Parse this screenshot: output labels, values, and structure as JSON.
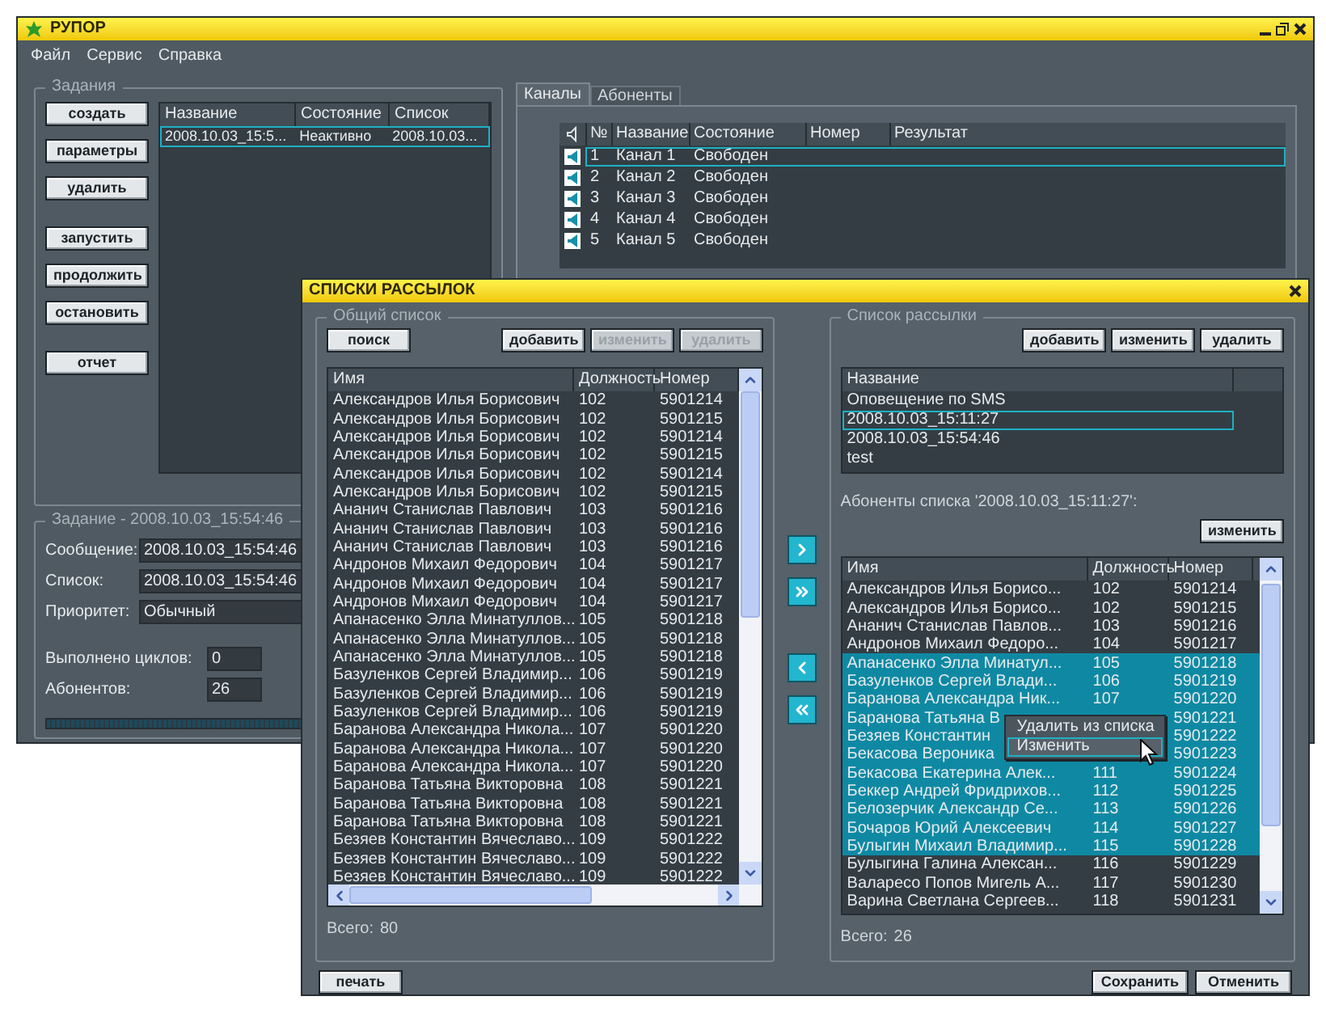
{
  "main_window": {
    "title": "РУПОР",
    "menu": [
      "Файл",
      "Сервис",
      "Справка"
    ],
    "tasks": {
      "title": "Задания",
      "button_groups": [
        [
          "создать",
          "параметры",
          "удалить"
        ],
        [
          "запустить",
          "продолжить",
          "остановить"
        ],
        [
          "отчет"
        ]
      ],
      "columns": [
        "Название",
        "Состояние",
        "Список"
      ],
      "rows": [
        {
          "cells": [
            "2008.10.03_15:5...",
            "Неактивно",
            "2008.10.03..."
          ],
          "selected": true
        }
      ]
    },
    "task": {
      "title": "Задание - 2008.10.03_15:54:46",
      "fields": [
        {
          "label": "Сообщение:",
          "value": "2008.10.03_15:54:46"
        },
        {
          "label": "Список:",
          "value": "2008.10.03_15:54:46"
        },
        {
          "label": "Приоритет:",
          "value": "Обычный"
        }
      ],
      "counters": [
        {
          "label": "Выполнено циклов:",
          "value": "0"
        },
        {
          "label": "Абонентов:",
          "value": "26"
        }
      ],
      "progress": {
        "level": 0
      }
    },
    "tabs": [
      {
        "label": "Каналы",
        "selected": true
      },
      {
        "label": "Абоненты",
        "selected": false
      }
    ],
    "channels": {
      "columns": [
        "№",
        "Название",
        "Состояние",
        "Номер",
        "Результат"
      ],
      "rows": [
        {
          "number": "1",
          "name": "Канал 1",
          "status": "Свободен",
          "selected": true
        },
        {
          "number": "2",
          "name": "Канал 2",
          "status": "Свободен",
          "selected": false
        },
        {
          "number": "3",
          "name": "Канал 3",
          "status": "Свободен",
          "selected": false
        },
        {
          "number": "4",
          "name": "Канал 4",
          "status": "Свободен",
          "selected": false
        },
        {
          "number": "5",
          "name": "Канал 5",
          "status": "Свободен",
          "selected": false
        }
      ]
    }
  },
  "dialog": {
    "title": "СПИСКИ РАССЫЛОК",
    "general_list": {
      "title": "Общий список",
      "search_button": "поиск",
      "buttons": [
        {
          "label": "добавить",
          "disabled": false
        },
        {
          "label": "изменить",
          "disabled": true
        },
        {
          "label": "удалить",
          "disabled": true
        }
      ],
      "columns": [
        "Имя",
        "Должность",
        "Номер"
      ],
      "rows": [
        [
          "Александров Илья Борисович",
          "102",
          "5901214"
        ],
        [
          "Александров Илья Борисович",
          "102",
          "5901215"
        ],
        [
          "Александров Илья Борисович",
          "102",
          "5901214"
        ],
        [
          "Александров Илья Борисович",
          "102",
          "5901215"
        ],
        [
          "Александров Илья Борисович",
          "102",
          "5901214"
        ],
        [
          "Александров Илья Борисович",
          "102",
          "5901215"
        ],
        [
          "Ананич Станислав Павлович",
          "103",
          "5901216"
        ],
        [
          "Ананич Станислав Павлович",
          "103",
          "5901216"
        ],
        [
          "Ананич Станислав Павлович",
          "103",
          "5901216"
        ],
        [
          "Андронов Михаил Федорович",
          "104",
          "5901217"
        ],
        [
          "Андронов Михаил Федорович",
          "104",
          "5901217"
        ],
        [
          "Андронов Михаил Федорович",
          "104",
          "5901217"
        ],
        [
          "Апанасенко Элла Минатуллов...",
          "105",
          "5901218"
        ],
        [
          "Апанасенко Элла Минатуллов...",
          "105",
          "5901218"
        ],
        [
          "Апанасенко Элла Минатуллов...",
          "105",
          "5901218"
        ],
        [
          "Базуленков Сергей Владимир...",
          "106",
          "5901219"
        ],
        [
          "Базуленков Сергей Владимир...",
          "106",
          "5901219"
        ],
        [
          "Базуленков Сергей Владимир...",
          "106",
          "5901219"
        ],
        [
          "Баранова Александра Никола...",
          "107",
          "5901220"
        ],
        [
          "Баранова Александра Никола...",
          "107",
          "5901220"
        ],
        [
          "Баранова Александра Никола...",
          "107",
          "5901220"
        ],
        [
          "Баранова Татьяна Викторовна",
          "108",
          "5901221"
        ],
        [
          "Баранова Татьяна Викторовна",
          "108",
          "5901221"
        ],
        [
          "Баранова Татьяна Викторовна",
          "108",
          "5901221"
        ],
        [
          "Безяев Константин Вячеславо...",
          "109",
          "5901222"
        ],
        [
          "Безяев Константин Вячеславо...",
          "109",
          "5901222"
        ],
        [
          "Безяев Константин Вячеславо...",
          "109",
          "5901222"
        ]
      ],
      "total_label": "Всего:",
      "total": "80"
    },
    "mailing_list": {
      "title": "Список рассылки",
      "buttons": [
        {
          "label": "добавить",
          "disabled": false
        },
        {
          "label": "изменить",
          "disabled": false
        },
        {
          "label": "удалить",
          "disabled": false
        }
      ],
      "column": "Название",
      "lists": [
        {
          "name": "Оповещение по SMS",
          "selected": false
        },
        {
          "name": "2008.10.03_15:11:27",
          "selected": true
        },
        {
          "name": "2008.10.03_15:54:46",
          "selected": false
        },
        {
          "name": "test",
          "selected": false
        }
      ],
      "subscribers_label": "Абоненты списка '2008.10.03_15:11:27':",
      "edit_button": "изменить",
      "columns": [
        "Имя",
        "Должность",
        "Номер"
      ],
      "rows": [
        {
          "cells": [
            "Александров Илья Борисо...",
            "102",
            "5901214"
          ],
          "selected": false
        },
        {
          "cells": [
            "Александров Илья Борисо...",
            "102",
            "5901215"
          ],
          "selected": false
        },
        {
          "cells": [
            "Ананич Станислав Павлов...",
            "103",
            "5901216"
          ],
          "selected": false
        },
        {
          "cells": [
            "Андронов Михаил Федоро...",
            "104",
            "5901217"
          ],
          "selected": false
        },
        {
          "cells": [
            "Апанасенко Элла Минатул...",
            "105",
            "5901218"
          ],
          "selected": true
        },
        {
          "cells": [
            "Базуленков Сергей Влади...",
            "106",
            "5901219"
          ],
          "selected": true
        },
        {
          "cells": [
            "Баранова Александра Ник...",
            "107",
            "5901220"
          ],
          "selected": true
        },
        {
          "cells": [
            "Баранова Татьяна В",
            null,
            "5901221"
          ],
          "selected": true
        },
        {
          "cells": [
            "Безяев Константин",
            null,
            "5901222"
          ],
          "selected": true
        },
        {
          "cells": [
            "Бекасова Вероника",
            null,
            "5901223"
          ],
          "selected": true
        },
        {
          "cells": [
            "Бекасова Екатерина Алек...",
            "111",
            "5901224"
          ],
          "selected": true
        },
        {
          "cells": [
            "Беккер Андрей Фридрихов...",
            "112",
            "5901225"
          ],
          "selected": true
        },
        {
          "cells": [
            "Белозерчик Александр Се...",
            "113",
            "5901226"
          ],
          "selected": true
        },
        {
          "cells": [
            "Бочаров Юрий Алексеевич",
            "114",
            "5901227"
          ],
          "selected": true
        },
        {
          "cells": [
            "Булыгин Михаил Владимир...",
            "115",
            "5901228"
          ],
          "selected": true
        },
        {
          "cells": [
            "Булыгина Галина Алексан...",
            "116",
            "5901229"
          ],
          "selected": false
        },
        {
          "cells": [
            "Валаресо Попов Мигель А...",
            "117",
            "5901230"
          ],
          "selected": false
        },
        {
          "cells": [
            "Варина Светлана Сергеев...",
            "118",
            "5901231"
          ],
          "selected": false
        }
      ],
      "context_menu": [
        {
          "label": "Удалить из списка",
          "selected": false
        },
        {
          "label": "Изменить",
          "selected": true
        }
      ],
      "total_label": "Всего:",
      "total": "26"
    },
    "move_buttons": [
      {
        "kind": "right"
      },
      {
        "kind": "all_right"
      },
      {
        "kind": "left"
      },
      {
        "kind": "all_left"
      }
    ],
    "print_button": "печать",
    "save_button": "Сохранить",
    "cancel_button": "Отменить"
  }
}
